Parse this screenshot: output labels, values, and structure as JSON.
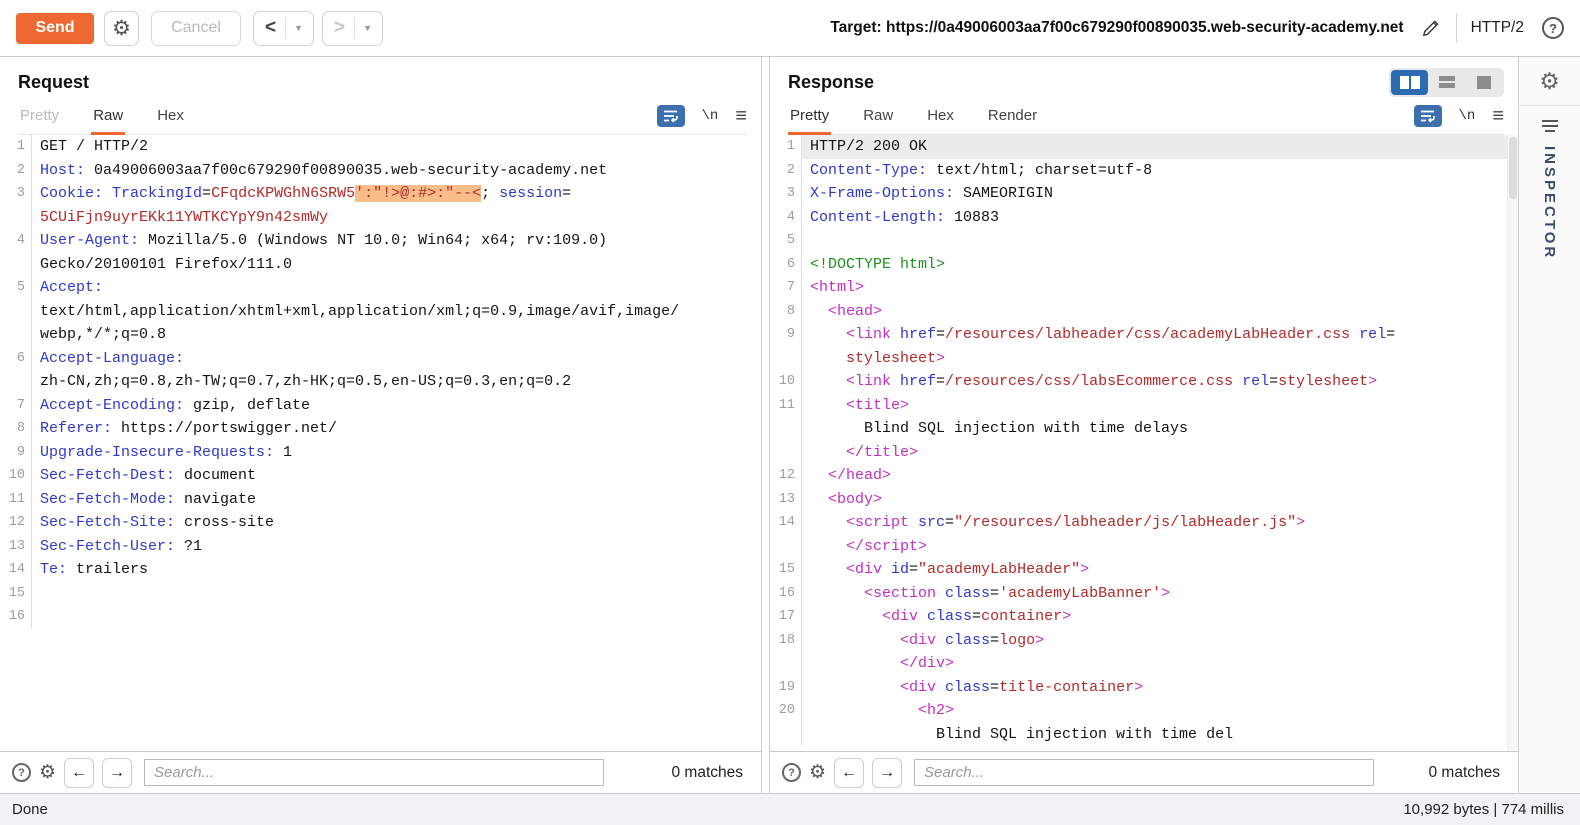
{
  "toolbar": {
    "send": "Send",
    "cancel": "Cancel",
    "back_glyph": "<",
    "forward_glyph": ">",
    "caret_glyph": "▼",
    "target_label": "Target:",
    "target_url": "https://0a49006003aa7f00c679290f00890035.web-security-academy.net",
    "http_version": "HTTP/2",
    "help_glyph": "?"
  },
  "request": {
    "title": "Request",
    "tabs": [
      {
        "label": "Pretty",
        "state": "disabled"
      },
      {
        "label": "Raw",
        "state": "active"
      },
      {
        "label": "Hex",
        "state": ""
      }
    ],
    "newline_glyph": "\\n",
    "search": {
      "placeholder": "Search...",
      "matches": "0 matches"
    },
    "rows": [
      {
        "n": "1",
        "s": [
          {
            "c": "n",
            "t": "GET / HTTP/2"
          }
        ]
      },
      {
        "n": "2",
        "s": [
          {
            "c": "h",
            "t": "Host:"
          },
          {
            "c": "n",
            "t": " 0a49006003aa7f00c679290f00890035.web-security-academy.net"
          }
        ]
      },
      {
        "n": "3",
        "s": [
          {
            "c": "h",
            "t": "Cookie:"
          },
          {
            "c": "n",
            "t": " "
          },
          {
            "c": "h",
            "t": "TrackingId"
          },
          {
            "c": "n",
            "t": "="
          },
          {
            "c": "v",
            "t": "CFqdcKPWGhN6SRW5"
          },
          {
            "c": "x",
            "t": "':\"!>@:#>:\"--<"
          },
          {
            "c": "n",
            "t": "; "
          },
          {
            "c": "h",
            "t": "session"
          },
          {
            "c": "n",
            "t": "="
          }
        ]
      },
      {
        "n": "",
        "s": [
          {
            "c": "v",
            "t": "5CUiFjn9uyrEKk11YWTKCYpY9n42smWy"
          }
        ]
      },
      {
        "n": "4",
        "s": [
          {
            "c": "h",
            "t": "User-Agent:"
          },
          {
            "c": "n",
            "t": " Mozilla/5.0 (Windows NT 10.0; Win64; x64; rv:109.0)"
          }
        ]
      },
      {
        "n": "",
        "s": [
          {
            "c": "n",
            "t": "Gecko/20100101 Firefox/111.0"
          }
        ]
      },
      {
        "n": "5",
        "s": [
          {
            "c": "h",
            "t": "Accept:"
          }
        ]
      },
      {
        "n": "",
        "s": [
          {
            "c": "n",
            "t": "text/html,application/xhtml+xml,application/xml;q=0.9,image/avif,image/"
          }
        ]
      },
      {
        "n": "",
        "s": [
          {
            "c": "n",
            "t": "webp,*/*;q=0.8"
          }
        ]
      },
      {
        "n": "6",
        "s": [
          {
            "c": "h",
            "t": "Accept-Language:"
          }
        ]
      },
      {
        "n": "",
        "s": [
          {
            "c": "n",
            "t": "zh-CN,zh;q=0.8,zh-TW;q=0.7,zh-HK;q=0.5,en-US;q=0.3,en;q=0.2"
          }
        ]
      },
      {
        "n": "7",
        "s": [
          {
            "c": "h",
            "t": "Accept-Encoding:"
          },
          {
            "c": "n",
            "t": " gzip, deflate"
          }
        ]
      },
      {
        "n": "8",
        "s": [
          {
            "c": "h",
            "t": "Referer:"
          },
          {
            "c": "n",
            "t": " https://portswigger.net/"
          }
        ]
      },
      {
        "n": "9",
        "s": [
          {
            "c": "h",
            "t": "Upgrade-Insecure-Requests:"
          },
          {
            "c": "n",
            "t": " 1"
          }
        ]
      },
      {
        "n": "10",
        "s": [
          {
            "c": "h",
            "t": "Sec-Fetch-Dest:"
          },
          {
            "c": "n",
            "t": " document"
          }
        ]
      },
      {
        "n": "11",
        "s": [
          {
            "c": "h",
            "t": "Sec-Fetch-Mode:"
          },
          {
            "c": "n",
            "t": " navigate"
          }
        ]
      },
      {
        "n": "12",
        "s": [
          {
            "c": "h",
            "t": "Sec-Fetch-Site:"
          },
          {
            "c": "n",
            "t": " cross-site"
          }
        ]
      },
      {
        "n": "13",
        "s": [
          {
            "c": "h",
            "t": "Sec-Fetch-User:"
          },
          {
            "c": "n",
            "t": " ?1"
          }
        ]
      },
      {
        "n": "14",
        "s": [
          {
            "c": "h",
            "t": "Te:"
          },
          {
            "c": "n",
            "t": " trailers"
          }
        ]
      },
      {
        "n": "15",
        "s": []
      },
      {
        "n": "16",
        "s": []
      }
    ]
  },
  "response": {
    "title": "Response",
    "tabs": [
      {
        "label": "Pretty",
        "state": "active"
      },
      {
        "label": "Raw",
        "state": ""
      },
      {
        "label": "Hex",
        "state": ""
      },
      {
        "label": "Render",
        "state": ""
      }
    ],
    "newline_glyph": "\\n",
    "search": {
      "placeholder": "Search...",
      "matches": "0 matches"
    },
    "rows": [
      {
        "n": "1",
        "hl": true,
        "s": [
          {
            "c": "n",
            "t": "HTTP/2 200 OK"
          }
        ]
      },
      {
        "n": "2",
        "s": [
          {
            "c": "h",
            "t": "Content-Type:"
          },
          {
            "c": "n",
            "t": " text/html; charset=utf-8"
          }
        ]
      },
      {
        "n": "3",
        "s": [
          {
            "c": "h",
            "t": "X-Frame-Options:"
          },
          {
            "c": "n",
            "t": " SAMEORIGIN"
          }
        ]
      },
      {
        "n": "4",
        "s": [
          {
            "c": "h",
            "t": "Content-Length:"
          },
          {
            "c": "n",
            "t": " 10883"
          }
        ]
      },
      {
        "n": "5",
        "s": []
      },
      {
        "n": "6",
        "s": [
          {
            "c": "d",
            "t": "<!DOCTYPE html>"
          }
        ]
      },
      {
        "n": "7",
        "s": [
          {
            "c": "t",
            "t": "<html>"
          }
        ]
      },
      {
        "n": "8",
        "s": [
          {
            "c": "t",
            "t": "  <head>"
          }
        ]
      },
      {
        "n": "9",
        "s": [
          {
            "c": "t",
            "t": "    <link "
          },
          {
            "c": "h",
            "t": "href"
          },
          {
            "c": "n",
            "t": "="
          },
          {
            "c": "v",
            "t": "/resources/labheader/css/academyLabHeader.css"
          },
          {
            "c": "n",
            "t": " "
          },
          {
            "c": "h",
            "t": "rel"
          },
          {
            "c": "n",
            "t": "="
          }
        ]
      },
      {
        "n": "",
        "s": [
          {
            "c": "v",
            "t": "    stylesheet"
          },
          {
            "c": "t",
            "t": ">"
          }
        ]
      },
      {
        "n": "10",
        "s": [
          {
            "c": "t",
            "t": "    <link "
          },
          {
            "c": "h",
            "t": "href"
          },
          {
            "c": "n",
            "t": "="
          },
          {
            "c": "v",
            "t": "/resources/css/labsEcommerce.css"
          },
          {
            "c": "n",
            "t": " "
          },
          {
            "c": "h",
            "t": "rel"
          },
          {
            "c": "n",
            "t": "="
          },
          {
            "c": "v",
            "t": "stylesheet"
          },
          {
            "c": "t",
            "t": ">"
          }
        ]
      },
      {
        "n": "11",
        "s": [
          {
            "c": "t",
            "t": "    <title>"
          }
        ]
      },
      {
        "n": "",
        "s": [
          {
            "c": "n",
            "t": "      Blind SQL injection with time delays"
          }
        ]
      },
      {
        "n": "",
        "s": [
          {
            "c": "t",
            "t": "    </title>"
          }
        ]
      },
      {
        "n": "12",
        "s": [
          {
            "c": "t",
            "t": "  </head>"
          }
        ]
      },
      {
        "n": "13",
        "s": [
          {
            "c": "t",
            "t": "  <body>"
          }
        ]
      },
      {
        "n": "14",
        "s": [
          {
            "c": "t",
            "t": "    <script "
          },
          {
            "c": "h",
            "t": "src"
          },
          {
            "c": "n",
            "t": "="
          },
          {
            "c": "v",
            "t": "\"/resources/labheader/js/labHeader.js\""
          },
          {
            "c": "t",
            "t": ">"
          }
        ]
      },
      {
        "n": "",
        "s": [
          {
            "c": "t",
            "t": "    </script>"
          }
        ]
      },
      {
        "n": "15",
        "s": [
          {
            "c": "t",
            "t": "    <div "
          },
          {
            "c": "h",
            "t": "id"
          },
          {
            "c": "n",
            "t": "="
          },
          {
            "c": "v",
            "t": "\"academyLabHeader\""
          },
          {
            "c": "t",
            "t": ">"
          }
        ]
      },
      {
        "n": "16",
        "s": [
          {
            "c": "t",
            "t": "      <section "
          },
          {
            "c": "h",
            "t": "class"
          },
          {
            "c": "n",
            "t": "="
          },
          {
            "c": "v",
            "t": "'academyLabBanner'"
          },
          {
            "c": "t",
            "t": ">"
          }
        ]
      },
      {
        "n": "17",
        "s": [
          {
            "c": "t",
            "t": "        <div "
          },
          {
            "c": "h",
            "t": "class"
          },
          {
            "c": "n",
            "t": "="
          },
          {
            "c": "v",
            "t": "container"
          },
          {
            "c": "t",
            "t": ">"
          }
        ]
      },
      {
        "n": "18",
        "s": [
          {
            "c": "t",
            "t": "          <div "
          },
          {
            "c": "h",
            "t": "class"
          },
          {
            "c": "n",
            "t": "="
          },
          {
            "c": "v",
            "t": "logo"
          },
          {
            "c": "t",
            "t": ">"
          }
        ]
      },
      {
        "n": "",
        "s": [
          {
            "c": "t",
            "t": "          </div>"
          }
        ]
      },
      {
        "n": "19",
        "s": [
          {
            "c": "t",
            "t": "          <div "
          },
          {
            "c": "h",
            "t": "class"
          },
          {
            "c": "n",
            "t": "="
          },
          {
            "c": "v",
            "t": "title-container"
          },
          {
            "c": "t",
            "t": ">"
          }
        ]
      },
      {
        "n": "20",
        "s": [
          {
            "c": "t",
            "t": "            <h2>"
          }
        ]
      },
      {
        "n": "",
        "s": [
          {
            "c": "n",
            "t": "              Blind SQL injection with time del"
          }
        ]
      }
    ]
  },
  "inspector": {
    "label": "INSPECTOR"
  },
  "statusbar": {
    "left": "Done",
    "right": "10,992 bytes | 774 millis"
  },
  "colors": {
    "accent_orange": "#ee6832",
    "syntax_header_name": "#3038c8",
    "syntax_value": "#b22a2a",
    "syntax_tag": "#c22fc2",
    "syntax_doctype": "#1e8e1e",
    "payload_highlight_bg": "#f8bd89",
    "active_layout_blue": "#2b6cb0"
  }
}
